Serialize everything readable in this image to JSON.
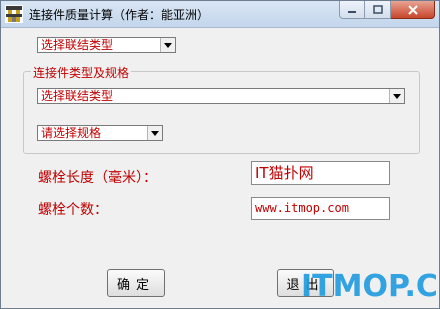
{
  "window": {
    "title": "连接件质量计算（作者：能亚洲）"
  },
  "caption_buttons": {
    "minimize_icon": "minimize-icon",
    "maximize_icon": "maximize-icon",
    "close_icon": "close-icon"
  },
  "top_select": {
    "value": "选择联结类型"
  },
  "group": {
    "legend": "连接件类型及规格",
    "type_select": {
      "value": "选择联结类型"
    },
    "spec_select": {
      "value": "请选择规格"
    }
  },
  "fields": {
    "length_label": "螺栓长度（毫米）：",
    "length_value": "IT猫扑网",
    "count_label": "螺栓个数：",
    "count_value": "www.itmop.com"
  },
  "buttons": {
    "ok_label": "确定",
    "exit_label": "退出"
  },
  "watermark": {
    "text": "ITMOP.COM"
  },
  "colors": {
    "label_red": "#c00000",
    "watermark_blue": "#1e9ae0"
  }
}
